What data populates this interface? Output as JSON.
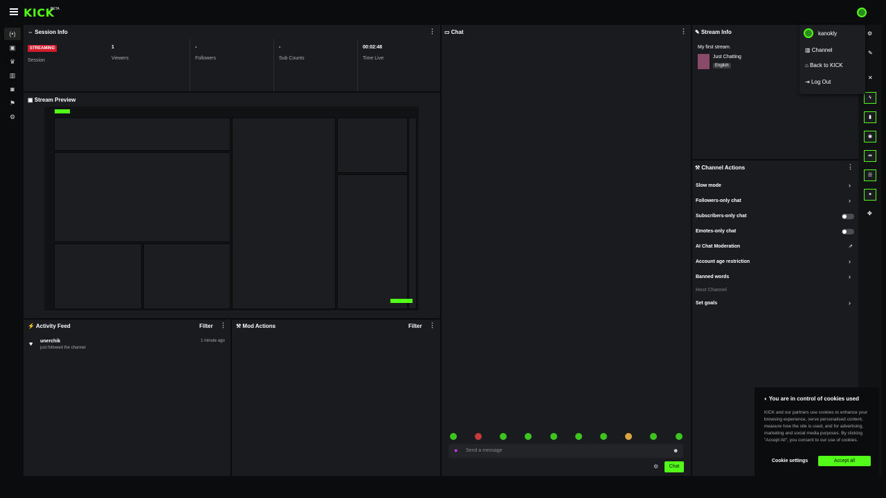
{
  "header": {
    "logo": "KICK",
    "beta": "BETA"
  },
  "session_info": {
    "title": "Session Info",
    "status_badge": "STREAMING",
    "status_label": "Session",
    "viewers_value": "1",
    "viewers_label": "Viewers",
    "followers_value": "-",
    "followers_label": "Followers",
    "subs_value": "-",
    "subs_label": "Sub Counts",
    "time_value": "00:02:48",
    "time_label": "Time Live"
  },
  "stream_preview": {
    "title": "Stream Preview"
  },
  "activity_feed": {
    "title": "Activity Feed",
    "filter_label": "Filter",
    "items": [
      {
        "user": "unerchik",
        "text": "just followed the channel",
        "time": "1 minute ago"
      }
    ]
  },
  "mod_actions": {
    "title": "Mod Actions",
    "filter_label": "Filter"
  },
  "chat": {
    "title": "Chat",
    "input_placeholder": "Send a message",
    "send_label": "Chat"
  },
  "stream_info": {
    "title": "Stream Info",
    "stream_title": "My first stream.",
    "category": "Just Chatting",
    "language_tag": "English"
  },
  "user_menu": {
    "username": "kanokly",
    "items": [
      "Channel",
      "Back to KICK",
      "Log Out"
    ]
  },
  "channel_actions": {
    "title": "Channel Actions",
    "items": [
      {
        "label": "Slow mode",
        "control": "chevron"
      },
      {
        "label": "Followers-only chat",
        "control": "chevron"
      },
      {
        "label": "Subscribers-only chat",
        "control": "toggle"
      },
      {
        "label": "Emotes-only chat",
        "control": "toggle"
      },
      {
        "label": "AI Chat Moderation",
        "control": "icon"
      },
      {
        "label": "Account age restriction",
        "control": "chevron"
      },
      {
        "label": "Banned words",
        "control": "chevron"
      }
    ],
    "host_channel": "Host Channel",
    "set_goals": "Set goals"
  },
  "cookie_banner": {
    "title": "You are in control of cookies used",
    "body": "KICK and our partners use cookies to enhance your browsing experience, serve personalised content, measure how the site is used, and for advertising, marketing and social media purposes. By clicking \"Accept All\", you consent to our use of cookies.",
    "settings_label": "Cookie settings",
    "accept_label": "Accept all"
  },
  "colors": {
    "accent": "#53fc18",
    "live": "#d21b2b",
    "panel": "#191b1f",
    "background": "#0b0c0d"
  },
  "icons": {
    "sidebar": [
      "broadcast-icon",
      "dashboard-icon",
      "trophy-icon",
      "analytics-icon",
      "camera-icon",
      "community-icon",
      "settings-icon"
    ],
    "right_strip": [
      "edit-icon",
      "close-icon",
      "lightning-icon",
      "clip-icon",
      "chat-icon",
      "raid-icon",
      "stack-icon",
      "wrench-icon",
      "more-icon"
    ]
  }
}
